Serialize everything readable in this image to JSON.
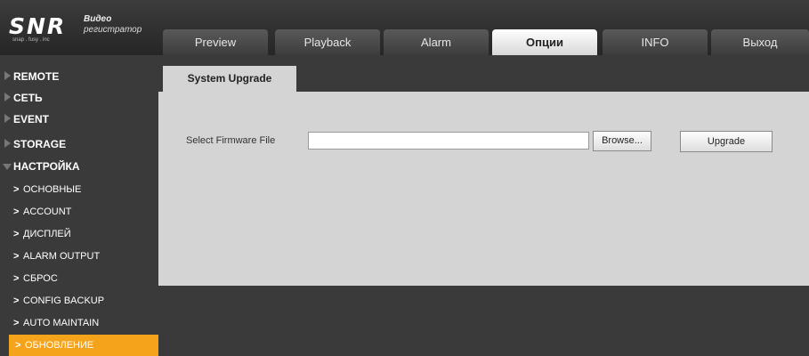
{
  "header": {
    "logo_mark": "SNR",
    "logo_line1": "Видео",
    "logo_line2": "регистратор",
    "logo_sub": "snap . fusy . inc"
  },
  "tabs": [
    {
      "label": "Preview"
    },
    {
      "label": "Playback"
    },
    {
      "label": "Alarm"
    },
    {
      "label": "Опции",
      "active": true
    },
    {
      "label": "INFO"
    },
    {
      "label": "Выход"
    }
  ],
  "sidebar": {
    "groups": [
      {
        "label": "REMOTE",
        "expanded": false
      },
      {
        "label": "СЕТЬ",
        "expanded": false
      },
      {
        "label": "EVENT",
        "expanded": false
      },
      {
        "label": "STORAGE",
        "expanded": false
      },
      {
        "label": "НАСТРОЙКА",
        "expanded": true
      }
    ],
    "subitems": [
      {
        "label": "ОСНОВНЫЕ"
      },
      {
        "label": "ACCOUNT"
      },
      {
        "label": "ДИСПЛЕЙ"
      },
      {
        "label": "ALARM OUTPUT"
      },
      {
        "label": "СБРОС"
      },
      {
        "label": "CONFIG BACKUP"
      },
      {
        "label": "AUTO MAINTAIN"
      },
      {
        "label": "ОБНОВЛЕНИЕ",
        "selected": true
      }
    ],
    "chevron": ">"
  },
  "content": {
    "tab_label": "System Upgrade",
    "field_label": "Select Firmware File",
    "file_value": "",
    "browse_label": "Browse...",
    "upgrade_label": "Upgrade"
  },
  "colors": {
    "accent": "#f5a31a",
    "background": "#3a3a3a",
    "panel": "#d4d4d4"
  }
}
